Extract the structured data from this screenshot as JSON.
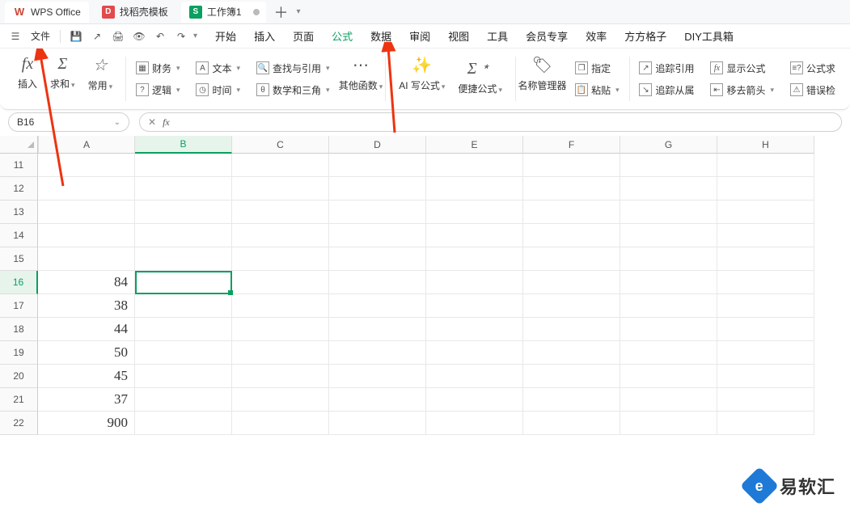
{
  "tabs": {
    "app": "WPS Office",
    "template": "找稻壳模板",
    "sheet": "工作簿1"
  },
  "file_label": "文件",
  "menu_tabs": [
    "开始",
    "插入",
    "页面",
    "公式",
    "数据",
    "审阅",
    "视图",
    "工具",
    "会员专享",
    "效率",
    "方方格子",
    "DIY工具箱"
  ],
  "menu_active_idx": 3,
  "ribbon": {
    "insert": "插入",
    "sum": "求和",
    "common": "常用",
    "finance": "财务",
    "text": "文本",
    "lookup": "查找与引用",
    "logic": "逻辑",
    "date": "时间",
    "math": "数学和三角",
    "other": "其他函数",
    "ai": "AI 写公式",
    "quick": "便捷公式",
    "name_mgr": "名称管理器",
    "paste": "粘贴",
    "assign": "指定",
    "trace_ref": "追踪引用",
    "show_formula": "显示公式",
    "formula_eval": "公式求",
    "trace_dep": "追踪从属",
    "move_arrow": "移去箭头",
    "error_check": "错误检"
  },
  "name_box": "B16",
  "formula_bar": "",
  "columns": [
    "A",
    "B",
    "C",
    "D",
    "E",
    "F",
    "G",
    "H"
  ],
  "rows": [
    {
      "n": 11,
      "vals": [
        "",
        "",
        "",
        "",
        "",
        "",
        "",
        ""
      ]
    },
    {
      "n": 12,
      "vals": [
        "",
        "",
        "",
        "",
        "",
        "",
        "",
        ""
      ]
    },
    {
      "n": 13,
      "vals": [
        "",
        "",
        "",
        "",
        "",
        "",
        "",
        ""
      ]
    },
    {
      "n": 14,
      "vals": [
        "",
        "",
        "",
        "",
        "",
        "",
        "",
        ""
      ]
    },
    {
      "n": 15,
      "vals": [
        "",
        "",
        "",
        "",
        "",
        "",
        "",
        ""
      ]
    },
    {
      "n": 16,
      "vals": [
        "84",
        "",
        "",
        "",
        "",
        "",
        "",
        ""
      ]
    },
    {
      "n": 17,
      "vals": [
        "38",
        "",
        "",
        "",
        "",
        "",
        "",
        ""
      ]
    },
    {
      "n": 18,
      "vals": [
        "44",
        "",
        "",
        "",
        "",
        "",
        "",
        ""
      ]
    },
    {
      "n": 19,
      "vals": [
        "50",
        "",
        "",
        "",
        "",
        "",
        "",
        ""
      ]
    },
    {
      "n": 20,
      "vals": [
        "45",
        "",
        "",
        "",
        "",
        "",
        "",
        ""
      ]
    },
    {
      "n": 21,
      "vals": [
        "37",
        "",
        "",
        "",
        "",
        "",
        "",
        ""
      ]
    },
    {
      "n": 22,
      "vals": [
        "900",
        "",
        "",
        "",
        "",
        "",
        "",
        ""
      ]
    }
  ],
  "selected_row_idx": 5,
  "selected_col_idx": 1,
  "watermark": "易软汇"
}
